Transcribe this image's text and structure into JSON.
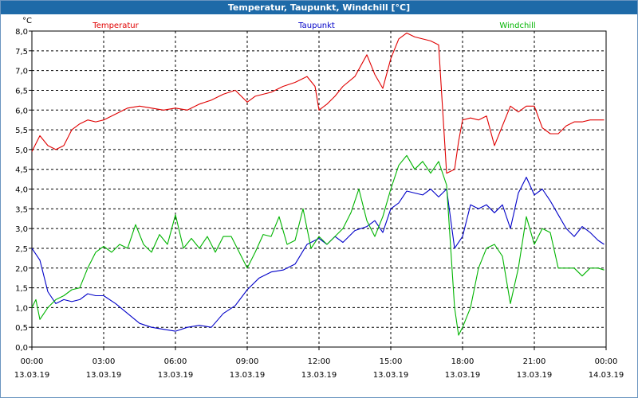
{
  "window": {
    "title": "Temperatur, Taupunkt, Windchill [°C]"
  },
  "chart_data": {
    "type": "line",
    "title": "Temperatur, Taupunkt, Windchill [°C]",
    "ylabel": "°C",
    "ylim": [
      0,
      8
    ],
    "yticks": [
      "0,0",
      "0,5",
      "1,0",
      "1,5",
      "2,0",
      "2,5",
      "3,0",
      "3,5",
      "4,0",
      "4,5",
      "5,0",
      "5,5",
      "6,0",
      "6,5",
      "7,0",
      "7,5",
      "8,0"
    ],
    "xlim": [
      "13.03.19 00:00",
      "14.03.19 00:00"
    ],
    "xticks": [
      {
        "time": "00:00",
        "date": "13.03.19"
      },
      {
        "time": "03:00",
        "date": "13.03.19"
      },
      {
        "time": "06:00",
        "date": "13.03.19"
      },
      {
        "time": "09:00",
        "date": "13.03.19"
      },
      {
        "time": "12:00",
        "date": "13.03.19"
      },
      {
        "time": "15:00",
        "date": "13.03.19"
      },
      {
        "time": "18:00",
        "date": "13.03.19"
      },
      {
        "time": "21:00",
        "date": "13.03.19"
      },
      {
        "time": "00:00",
        "date": "14.03.19"
      }
    ],
    "grid": true,
    "legend_position": "top",
    "series": [
      {
        "name": "Temperatur",
        "color": "#e00000",
        "x": [
          "00:00",
          "00:20",
          "00:40",
          "01:00",
          "01:20",
          "01:40",
          "02:00",
          "02:20",
          "02:40",
          "03:00",
          "03:20",
          "03:40",
          "04:00",
          "04:30",
          "05:00",
          "05:30",
          "06:00",
          "06:30",
          "07:00",
          "07:30",
          "08:00",
          "08:30",
          "09:00",
          "09:20",
          "09:40",
          "10:00",
          "10:30",
          "11:00",
          "11:30",
          "11:50",
          "12:00",
          "12:20",
          "12:40",
          "13:00",
          "13:30",
          "14:00",
          "14:20",
          "14:40",
          "15:00",
          "15:20",
          "15:40",
          "16:00",
          "16:20",
          "16:40",
          "17:00",
          "17:20",
          "17:40",
          "17:50",
          "18:00",
          "18:20",
          "18:40",
          "19:00",
          "19:20",
          "19:40",
          "20:00",
          "20:20",
          "20:40",
          "21:00",
          "21:20",
          "21:40",
          "22:00",
          "22:20",
          "22:40",
          "23:00",
          "23:20",
          "23:40",
          "23:55"
        ],
        "values": [
          4.95,
          5.35,
          5.1,
          5.0,
          5.1,
          5.5,
          5.65,
          5.75,
          5.7,
          5.75,
          5.85,
          5.95,
          6.05,
          6.1,
          6.05,
          6.0,
          6.05,
          6.0,
          6.15,
          6.25,
          6.4,
          6.5,
          6.2,
          6.35,
          6.4,
          6.45,
          6.6,
          6.7,
          6.85,
          6.6,
          6.0,
          6.15,
          6.35,
          6.6,
          6.85,
          7.4,
          6.9,
          6.55,
          7.3,
          7.8,
          7.95,
          7.85,
          7.8,
          7.75,
          7.65,
          4.4,
          4.5,
          5.2,
          5.75,
          5.8,
          5.75,
          5.85,
          5.1,
          5.6,
          6.1,
          5.95,
          6.1,
          6.1,
          5.55,
          5.4,
          5.4,
          5.6,
          5.7,
          5.7,
          5.75,
          5.75,
          5.75
        ]
      },
      {
        "name": "Taupunkt",
        "color": "#0000c8",
        "x": [
          "00:00",
          "00:20",
          "00:40",
          "01:00",
          "01:20",
          "01:40",
          "02:00",
          "02:20",
          "02:40",
          "03:00",
          "03:30",
          "04:00",
          "04:30",
          "05:00",
          "05:30",
          "06:00",
          "06:30",
          "07:00",
          "07:30",
          "08:00",
          "08:30",
          "09:00",
          "09:30",
          "10:00",
          "10:30",
          "11:00",
          "11:30",
          "12:00",
          "12:20",
          "12:40",
          "13:00",
          "13:30",
          "14:00",
          "14:20",
          "14:40",
          "15:00",
          "15:20",
          "15:40",
          "16:00",
          "16:20",
          "16:40",
          "17:00",
          "17:20",
          "17:40",
          "18:00",
          "18:20",
          "18:40",
          "19:00",
          "19:20",
          "19:40",
          "20:00",
          "20:20",
          "20:40",
          "21:00",
          "21:20",
          "21:40",
          "22:00",
          "22:20",
          "22:40",
          "23:00",
          "23:20",
          "23:40",
          "23:55"
        ],
        "values": [
          2.5,
          2.2,
          1.4,
          1.1,
          1.2,
          1.15,
          1.2,
          1.35,
          1.3,
          1.3,
          1.1,
          0.85,
          0.6,
          0.5,
          0.45,
          0.4,
          0.5,
          0.55,
          0.5,
          0.85,
          1.05,
          1.45,
          1.75,
          1.9,
          1.95,
          2.1,
          2.6,
          2.75,
          2.6,
          2.8,
          2.65,
          2.95,
          3.05,
          3.2,
          2.9,
          3.5,
          3.65,
          3.95,
          3.9,
          3.85,
          4.0,
          3.8,
          4.0,
          2.5,
          2.8,
          3.6,
          3.5,
          3.6,
          3.4,
          3.6,
          3.0,
          3.9,
          4.3,
          3.85,
          4.0,
          3.7,
          3.35,
          3.0,
          2.8,
          3.05,
          2.9,
          2.7,
          2.6
        ]
      },
      {
        "name": "Windchill",
        "color": "#00b400",
        "x": [
          "00:00",
          "00:10",
          "00:20",
          "00:40",
          "01:00",
          "01:20",
          "01:40",
          "02:00",
          "02:20",
          "02:40",
          "03:00",
          "03:20",
          "03:40",
          "04:00",
          "04:20",
          "04:40",
          "05:00",
          "05:20",
          "05:40",
          "06:00",
          "06:20",
          "06:40",
          "07:00",
          "07:20",
          "07:40",
          "08:00",
          "08:20",
          "08:40",
          "09:00",
          "09:20",
          "09:40",
          "10:00",
          "10:20",
          "10:40",
          "11:00",
          "11:20",
          "11:40",
          "12:00",
          "12:20",
          "12:40",
          "13:00",
          "13:20",
          "13:40",
          "14:00",
          "14:20",
          "14:40",
          "15:00",
          "15:20",
          "15:40",
          "16:00",
          "16:20",
          "16:40",
          "17:00",
          "17:20",
          "17:40",
          "17:50",
          "18:00",
          "18:20",
          "18:40",
          "19:00",
          "19:20",
          "19:40",
          "20:00",
          "20:20",
          "20:40",
          "21:00",
          "21:20",
          "21:40",
          "22:00",
          "22:20",
          "22:40",
          "23:00",
          "23:20",
          "23:40",
          "23:55"
        ],
        "values": [
          1.0,
          1.2,
          0.7,
          1.0,
          1.2,
          1.3,
          1.45,
          1.5,
          2.0,
          2.4,
          2.55,
          2.4,
          2.6,
          2.5,
          3.1,
          2.6,
          2.4,
          2.85,
          2.6,
          3.35,
          2.5,
          2.75,
          2.5,
          2.8,
          2.4,
          2.8,
          2.8,
          2.4,
          2.0,
          2.4,
          2.85,
          2.8,
          3.3,
          2.6,
          2.7,
          3.5,
          2.5,
          2.8,
          2.6,
          2.8,
          3.0,
          3.4,
          4.0,
          3.2,
          2.8,
          3.3,
          4.0,
          4.6,
          4.85,
          4.5,
          4.7,
          4.4,
          4.7,
          4.1,
          1.0,
          0.3,
          0.5,
          1.0,
          2.0,
          2.5,
          2.6,
          2.3,
          1.1,
          2.0,
          3.3,
          2.6,
          3.0,
          2.9,
          2.0,
          2.0,
          2.0,
          1.8,
          2.0,
          2.0,
          1.95
        ]
      }
    ]
  }
}
